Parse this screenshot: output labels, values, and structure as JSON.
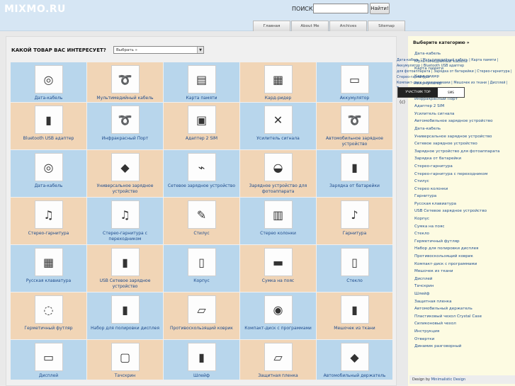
{
  "header": {
    "logo": "MIXMO.RU",
    "search_label": "ПОИСК:",
    "search_value": "",
    "search_button": "Найти!",
    "nav": [
      "Главная",
      "About Me",
      "Archives",
      "Sitemap"
    ]
  },
  "main": {
    "question": "КАКОЙ ТОВАР ВАС ИНТЕРЕСУЕТ?",
    "select_value": "Выбрать »",
    "items": [
      {
        "label": "Дата-кабель",
        "icon": "cd-cable-icon",
        "glyph": "◎"
      },
      {
        "label": "Мультимедийный кабель",
        "icon": "av-cable-icon",
        "glyph": "➰"
      },
      {
        "label": "Карта памяти",
        "icon": "memory-card-icon",
        "glyph": "▤"
      },
      {
        "label": "Кард-ридер",
        "icon": "card-reader-icon",
        "glyph": "▦"
      },
      {
        "label": "Аккумулятор",
        "icon": "battery-icon",
        "glyph": "▭"
      },
      {
        "label": "Bluetooth USB адаптер",
        "icon": "bluetooth-adapter-icon",
        "glyph": "▮"
      },
      {
        "label": "Инфракрасный Порт",
        "icon": "infrared-port-icon",
        "glyph": "➰"
      },
      {
        "label": "Адаптер 2 SIM",
        "icon": "sim-adapter-icon",
        "glyph": "▣"
      },
      {
        "label": "Усилитель сигнала",
        "icon": "signal-booster-icon",
        "glyph": "✕"
      },
      {
        "label": "Автомобильное зарядное устройство",
        "icon": "car-charger-icon",
        "glyph": "➰"
      },
      {
        "label": "Дата-кабель",
        "icon": "data-cable-icon",
        "glyph": "◎"
      },
      {
        "label": "Универсальное зарядное устройство",
        "icon": "universal-charger-icon",
        "glyph": "◆"
      },
      {
        "label": "Сетевое зарядное устройство",
        "icon": "wall-charger-icon",
        "glyph": "⌁"
      },
      {
        "label": "Зарядное устройство для фотоаппарата",
        "icon": "camera-charger-icon",
        "glyph": "◒"
      },
      {
        "label": "Зарядка от батарейки",
        "icon": "battery-charger-icon",
        "glyph": "▮"
      },
      {
        "label": "Стерео-гарнитура",
        "icon": "stereo-headset-icon",
        "glyph": "♫"
      },
      {
        "label": "Стерео-гарнитура с переходником",
        "icon": "headset-adapter-icon",
        "glyph": "♫"
      },
      {
        "label": "Стилус",
        "icon": "stylus-icon",
        "glyph": "✎"
      },
      {
        "label": "Стерео колонки",
        "icon": "speakers-icon",
        "glyph": "▥"
      },
      {
        "label": "Гарнитура",
        "icon": "headset-icon",
        "glyph": "♪"
      },
      {
        "label": "Русская клавиатура",
        "icon": "keyboard-icon",
        "glyph": "▦"
      },
      {
        "label": "USB Сетевое зарядное устройство",
        "icon": "usb-charger-icon",
        "glyph": "▮"
      },
      {
        "label": "Корпус",
        "icon": "phone-case-icon",
        "glyph": "▯"
      },
      {
        "label": "Сумка на пояс",
        "icon": "belt-bag-icon",
        "glyph": "▬"
      },
      {
        "label": "Стекло",
        "icon": "glass-icon",
        "glyph": "▯"
      },
      {
        "label": "Герметичный футляр",
        "icon": "waterproof-case-icon",
        "glyph": "◌"
      },
      {
        "label": "Набор для полировки дисплея",
        "icon": "polish-kit-icon",
        "glyph": "▮"
      },
      {
        "label": "Противоскользящий коврик",
        "icon": "mat-icon",
        "glyph": "▱"
      },
      {
        "label": "Компакт-диск с программами",
        "icon": "cd-icon",
        "glyph": "◉"
      },
      {
        "label": "Мешочек из ткани",
        "icon": "pouch-icon",
        "glyph": "▮"
      },
      {
        "label": "Дисплей",
        "icon": "display-icon",
        "glyph": "▭"
      },
      {
        "label": "Тачскрин",
        "icon": "touchscreen-icon",
        "glyph": "▢"
      },
      {
        "label": "Шлейф",
        "icon": "cable-ribbon-icon",
        "glyph": "▮"
      },
      {
        "label": "Защитная пленка",
        "icon": "film-icon",
        "glyph": "▱"
      },
      {
        "label": "Автомобильный держатель",
        "icon": "car-holder-icon",
        "glyph": "◆"
      }
    ]
  },
  "sidebar": {
    "title": "Выберите категорию »",
    "items": [
      "Дата-кабель",
      "Мультимедийный кабель",
      "Карта памяти",
      "Кард-ридер",
      "Аккумулятор",
      "Bluetooth USB адаптер",
      "Инфракрасный Порт",
      "Адаптер 2 SIM",
      "Усилитель сигнала",
      "Автомобильное зарядное устройство",
      "Дата-кабель",
      "Универсальное зарядное устройство",
      "Сетевое зарядное устройство",
      "Зарядное устройство для фотоаппарата",
      "Зарядка от батарейки",
      "Стерео-гарнитура",
      "Стерео-гарнитура с переходником",
      "Стилус",
      "Стерео колонки",
      "Гарнитура",
      "Русская клавиатура",
      "USB Сетевое зарядное устройство",
      "Корпус",
      "Сумка на пояс",
      "Стекло",
      "Герметичный футляр",
      "Набор для полировки дисплея",
      "Противоскользящий коврик",
      "Компакт-диск с программами",
      "Мешочек из ткани",
      "Дисплей",
      "Тачскрин",
      "Шлейф",
      "Защитная пленка",
      "Автомобильный держатель",
      "Пластиковый чехол Crystal Case",
      "Силиконовый чехол",
      "Инструкция",
      "Отвертки",
      "Динамик разговорный"
    ],
    "crumbs_line1": "Дата-кабель | Мультимедийный кабель | Карта памяти | Аккумулятор | Bluetooth USB адаптер",
    "crumbs_line2": "для фотоаппарата | Зарядка от батарейки | Стерео-гарнитура | Стерео-гарнитура",
    "crumbs_line3": "Компакт-диск с программами | Мешочек из ткани | Дисплей | Тачскрин",
    "badge_left": "УЧАСТНИК TOP",
    "badge_right": "SMS",
    "copyright": "(c)",
    "footer_prefix": "Design by",
    "footer_link": "Minimalistic Design"
  },
  "colors": {
    "header_bg": "#d6e6f4",
    "cell_blue": "#b8d6ec",
    "cell_tan": "#f1d5b6",
    "sidebar_bg": "#fdfbe2",
    "link": "#1d4d8f"
  }
}
